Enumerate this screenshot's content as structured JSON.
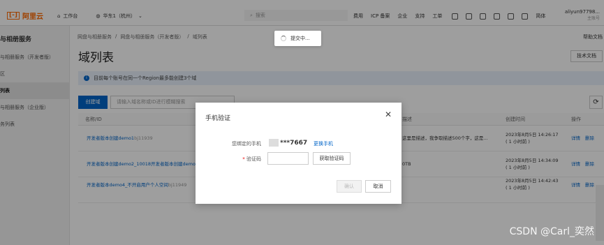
{
  "header": {
    "logo_text": "阿里云",
    "logo_mark": "[-]",
    "workbench": "工作台",
    "region": "华东1（杭州）",
    "search_placeholder": "搜索",
    "nav": [
      "费用",
      "ICP 备案",
      "企业",
      "支持",
      "工单"
    ],
    "lang": "简体",
    "user_name": "aliyun97798...",
    "user_sub": "主账号"
  },
  "sidebar": {
    "title": "与相册服务",
    "items": [
      "与相册服务（开发者版）",
      "区",
      "列表",
      "与相册服务（企业版）",
      "务列表"
    ],
    "active_index": 2
  },
  "main": {
    "breadcrumbs": [
      "网盘与相册服务",
      "/",
      "网盘与相册服务（开发者版）",
      "/",
      "域列表"
    ],
    "help_text": "帮助文档",
    "title": "域列表",
    "tech_doc": "技术文档",
    "notice": "目前每个账号在同一个Region最多能创建3个域",
    "create_button": "创建域",
    "search_placeholder": "请输入域名称或ID进行模糊搜索",
    "columns": [
      "名称/ID",
      "描述",
      "创建时间",
      "操作"
    ],
    "rows": [
      {
        "name": "开发者版本创建demo1",
        "id": "bj11939",
        "desc": "这里是描述，我争取描述500个字，这是...",
        "created": "2023年8月5日 14:26:17",
        "ago": "( 1 小时前 )",
        "actions": [
          "详情",
          "删除"
        ]
      },
      {
        "name": "开发者版本创建demo2_10018开发者版本创建demo",
        "id": "",
        "desc": "0TB",
        "created": "2023年8月5日 14:34:09",
        "ago": "( 1 小时前 )",
        "actions": [
          "详情",
          "删除"
        ]
      },
      {
        "name": "开发者版本demo4_不开启用户个人空间",
        "id": "bj11949",
        "desc": "",
        "created": "2023年8月5日 14:42:43",
        "ago": "( 1 小时前 )",
        "actions": [
          "详情",
          "删除"
        ]
      }
    ]
  },
  "toast": {
    "text": "提交中..."
  },
  "modal": {
    "title": "手机验证",
    "phone_label": "您绑定的手机",
    "phone_value": "***7667",
    "change_phone": "更换手机",
    "code_label": "验证码",
    "required_mark": "*",
    "get_code": "获取验证码",
    "confirm": "确认",
    "cancel": "取消"
  },
  "watermark": "CSDN @Carl_奕然"
}
